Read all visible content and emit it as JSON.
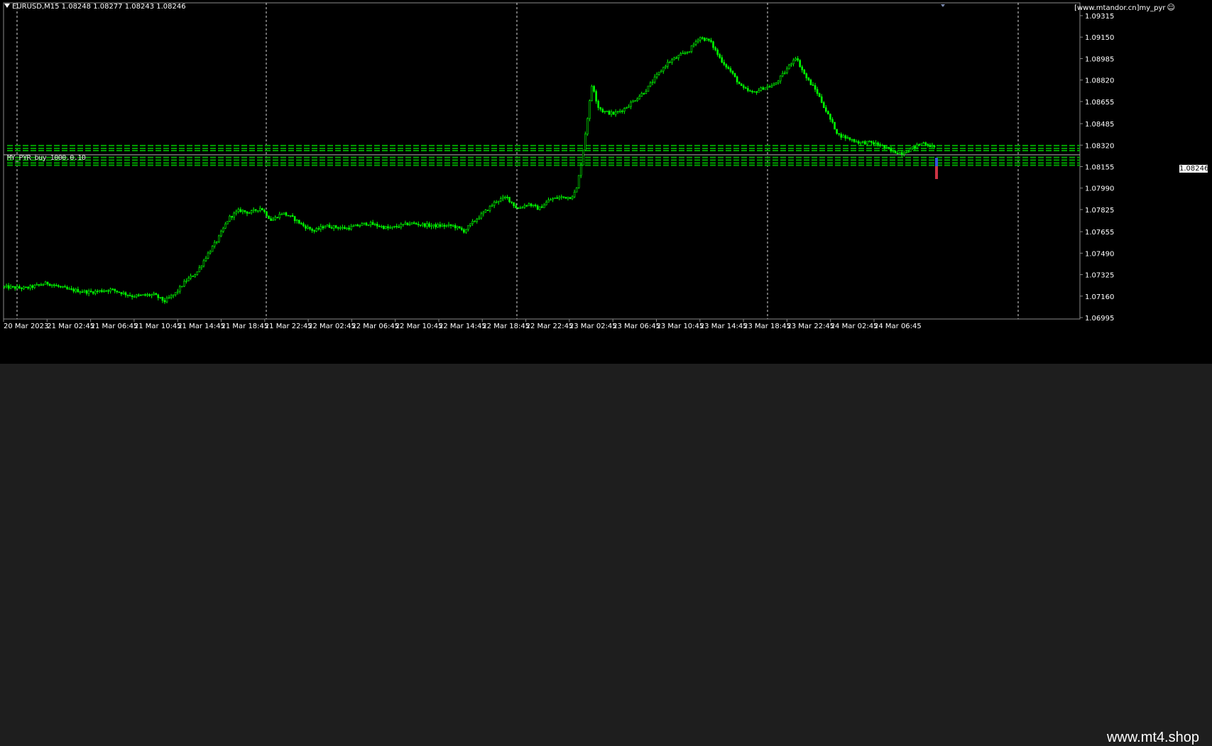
{
  "header": {
    "symbol_line": "EURUSD,M15  1.08248 1.08277 1.08243 1.08246",
    "brand": "[www.mtandor.cn]my_pyr"
  },
  "ea_label": "MY_PYR buy 1000.0.10",
  "current_price": "1.08246",
  "watermark": "www.mt4.shop",
  "colors": {
    "background": "#000000",
    "candle": "#00ff00",
    "grid": "#ffffff",
    "pending_orders": "#00a000"
  },
  "chart_data": {
    "type": "candlestick",
    "title": "EURUSD,M15",
    "y_ticks": [
      "1.09315",
      "1.09150",
      "1.08985",
      "1.08820",
      "1.08655",
      "1.08485",
      "1.08320",
      "1.08155",
      "1.07990",
      "1.07825",
      "1.07655",
      "1.07490",
      "1.07325",
      "1.07160",
      "1.06995"
    ],
    "ylim": [
      1.06975,
      1.09355
    ],
    "x_ticks": [
      "20 Mar 2023",
      "21 Mar 02:45",
      "21 Mar 06:45",
      "21 Mar 10:45",
      "21 Mar 14:45",
      "21 Mar 18:45",
      "21 Mar 22:45",
      "22 Mar 02:45",
      "22 Mar 06:45",
      "22 Mar 10:45",
      "22 Mar 14:45",
      "22 Mar 18:45",
      "22 Mar 22:45",
      "23 Mar 02:45",
      "23 Mar 06:45",
      "23 Mar 10:45",
      "23 Mar 14:45",
      "23 Mar 18:45",
      "23 Mar 22:45",
      "24 Mar 02:45",
      "24 Mar 06:45"
    ],
    "period_separators": [
      "21 Mar",
      "22 Mar",
      "23 Mar",
      "24 Mar"
    ],
    "price_path": [
      [
        0,
        1.0723
      ],
      [
        4,
        1.0722
      ],
      [
        8,
        1.0726
      ],
      [
        12,
        1.0721
      ],
      [
        16,
        1.0719
      ],
      [
        20,
        1.0721
      ],
      [
        24,
        1.0716
      ],
      [
        28,
        1.0717
      ],
      [
        30,
        1.0712
      ],
      [
        32,
        1.0718
      ],
      [
        34,
        1.0728
      ],
      [
        36,
        1.0734
      ],
      [
        38,
        1.0748
      ],
      [
        40,
        1.076
      ],
      [
        42,
        1.0776
      ],
      [
        44,
        1.0782
      ],
      [
        46,
        1.078
      ],
      [
        48,
        1.0784
      ],
      [
        50,
        1.0774
      ],
      [
        52,
        1.078
      ],
      [
        54,
        1.0776
      ],
      [
        56,
        1.077
      ],
      [
        58,
        1.0766
      ],
      [
        60,
        1.077
      ],
      [
        64,
        1.0768
      ],
      [
        68,
        1.0772
      ],
      [
        72,
        1.0768
      ],
      [
        76,
        1.0772
      ],
      [
        80,
        1.077
      ],
      [
        84,
        1.077
      ],
      [
        86,
        1.0766
      ],
      [
        88,
        1.0774
      ],
      [
        90,
        1.0781
      ],
      [
        92,
        1.0789
      ],
      [
        94,
        1.0792
      ],
      [
        96,
        1.0783
      ],
      [
        98,
        1.0787
      ],
      [
        100,
        1.0783
      ],
      [
        102,
        1.079
      ],
      [
        104,
        1.0792
      ],
      [
        106,
        1.0792
      ],
      [
        107,
        1.0797
      ],
      [
        108,
        1.082
      ],
      [
        109,
        1.085
      ],
      [
        110,
        1.088
      ],
      [
        111,
        1.0862
      ],
      [
        112,
        1.0858
      ],
      [
        114,
        1.0856
      ],
      [
        116,
        1.086
      ],
      [
        118,
        1.0867
      ],
      [
        120,
        1.0874
      ],
      [
        122,
        1.0885
      ],
      [
        124,
        1.0895
      ],
      [
        126,
        1.09
      ],
      [
        128,
        1.0904
      ],
      [
        130,
        1.0915
      ],
      [
        132,
        1.0912
      ],
      [
        134,
        1.0898
      ],
      [
        136,
        1.0888
      ],
      [
        138,
        1.0876
      ],
      [
        140,
        1.0872
      ],
      [
        142,
        1.0876
      ],
      [
        144,
        1.0878
      ],
      [
        146,
        1.0888
      ],
      [
        148,
        1.09
      ],
      [
        150,
        1.0884
      ],
      [
        152,
        1.0873
      ],
      [
        154,
        1.0856
      ],
      [
        156,
        1.084
      ],
      [
        158,
        1.0837
      ],
      [
        160,
        1.0834
      ],
      [
        162,
        1.0834
      ],
      [
        164,
        1.0832
      ],
      [
        166,
        1.0827
      ],
      [
        168,
        1.0826
      ],
      [
        170,
        1.083
      ],
      [
        172,
        1.0834
      ],
      [
        174,
        1.083
      ]
    ],
    "pending_levels": [
      1.08317,
      1.08295,
      1.08278,
      1.08225,
      1.08205,
      1.08183,
      1.08165
    ]
  }
}
